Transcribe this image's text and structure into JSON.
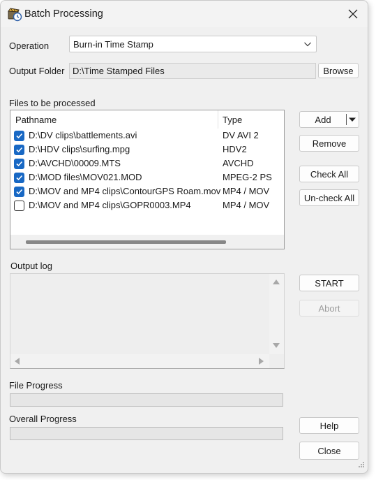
{
  "window": {
    "title": "Batch Processing",
    "icon": "clapperboard-clock-icon"
  },
  "form": {
    "operation_label": "Operation",
    "operation_value": "Burn-in Time Stamp",
    "output_folder_label": "Output Folder",
    "output_folder_value": "D:\\Time Stamped Files",
    "browse_label": "Browse"
  },
  "files": {
    "label": "Files to be processed",
    "columns": [
      "Pathname",
      "Type"
    ],
    "rows": [
      {
        "path": "D:\\DV clips\\battlements.avi",
        "type": "DV AVI 2",
        "checked": true
      },
      {
        "path": "D:\\HDV clips\\surfing.mpg",
        "type": "HDV2",
        "checked": true
      },
      {
        "path": "D:\\AVCHD\\00009.MTS",
        "type": "AVCHD",
        "checked": true
      },
      {
        "path": "D:\\MOD files\\MOV021.MOD",
        "type": "MPEG-2 PS",
        "checked": true
      },
      {
        "path": "D:\\MOV and MP4 clips\\ContourGPS Roam.mov",
        "type": "MP4 / MOV",
        "checked": true
      },
      {
        "path": "D:\\MOV and MP4 clips\\GOPR0003.MP4",
        "type": "MP4 / MOV",
        "checked": false
      }
    ]
  },
  "buttons": {
    "add": "Add",
    "remove": "Remove",
    "check_all": "Check All",
    "uncheck_all": "Un-check All",
    "start": "START",
    "abort": "Abort",
    "help": "Help",
    "close": "Close"
  },
  "log": {
    "label": "Output log"
  },
  "progress": {
    "file_label": "File Progress",
    "file_value": 0,
    "overall_label": "Overall Progress",
    "overall_value": 0
  },
  "colors": {
    "checkbox_accent": "#1868c4"
  }
}
